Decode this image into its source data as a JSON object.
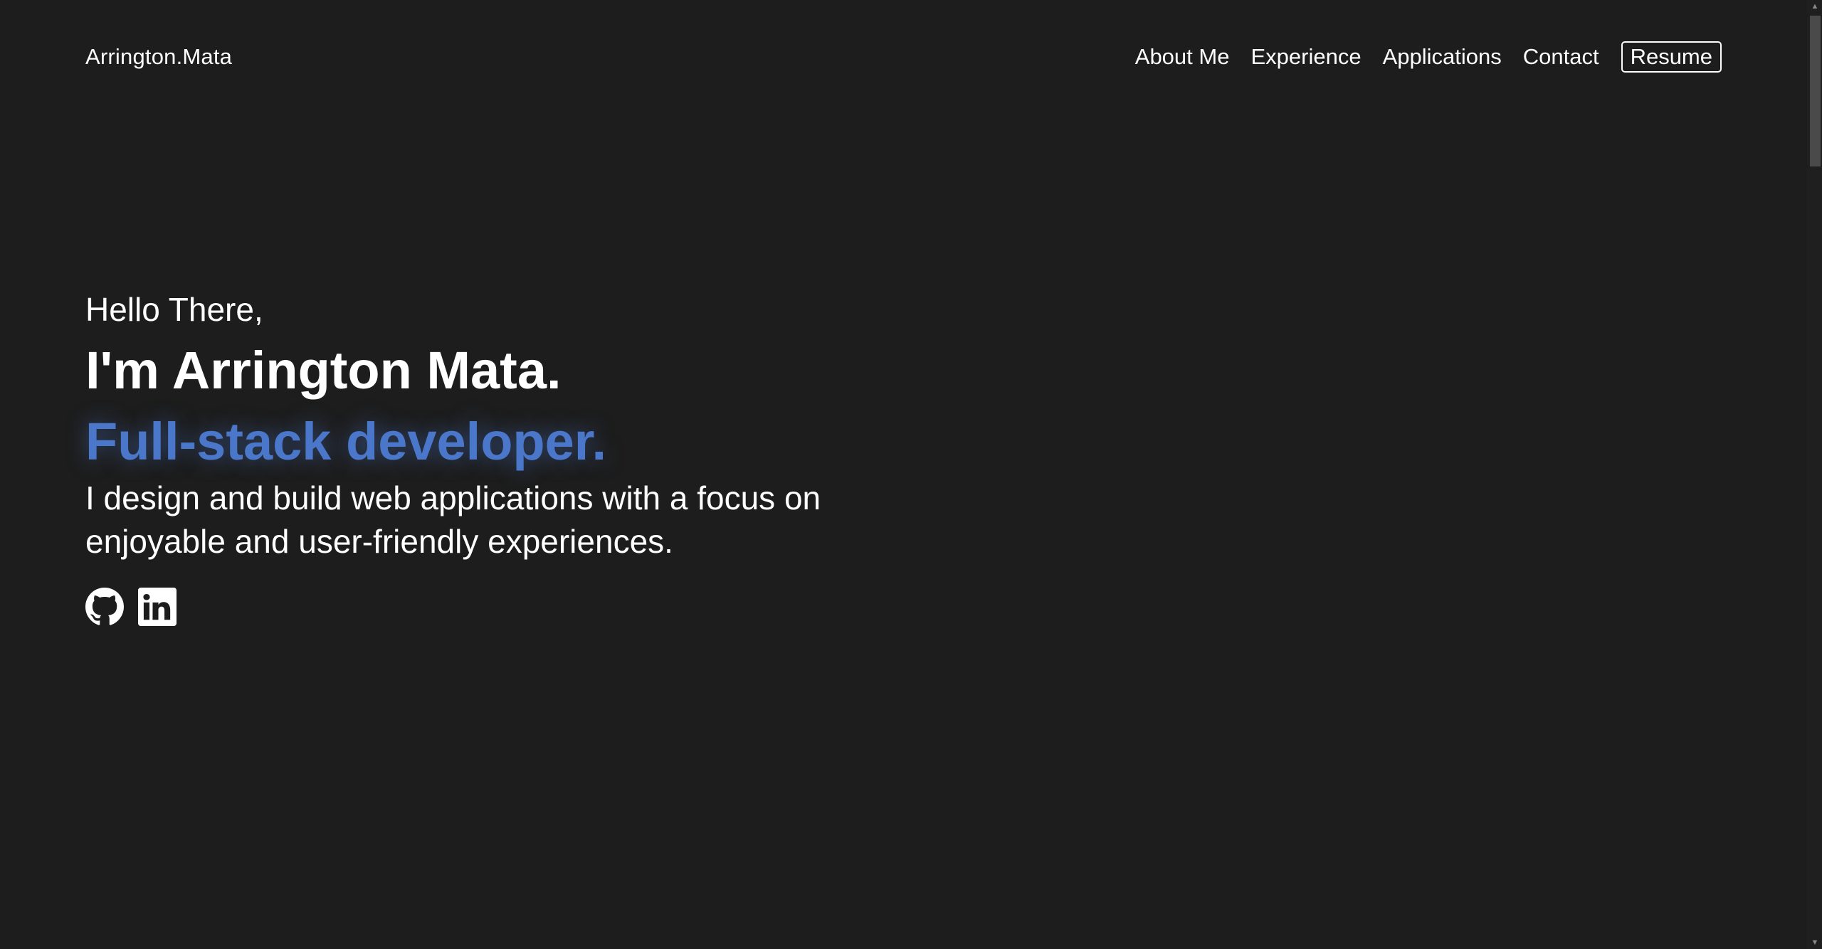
{
  "header": {
    "brand": "Arrington.Mata",
    "nav": [
      {
        "label": "About Me"
      },
      {
        "label": "Experience"
      },
      {
        "label": "Applications"
      },
      {
        "label": "Contact"
      }
    ],
    "resume_label": "Resume"
  },
  "hero": {
    "greeting": "Hello There,",
    "name": "I'm Arrington Mata.",
    "role": "Full-stack developer.",
    "tagline": "I design and build web applications with a focus on enjoyable and user-friendly experiences.",
    "socials": [
      {
        "icon": "github-icon"
      },
      {
        "icon": "linkedin-icon"
      }
    ]
  },
  "colors": {
    "background": "#1d1d1d",
    "text": "#ffffff",
    "accent": "#4a77c9"
  }
}
